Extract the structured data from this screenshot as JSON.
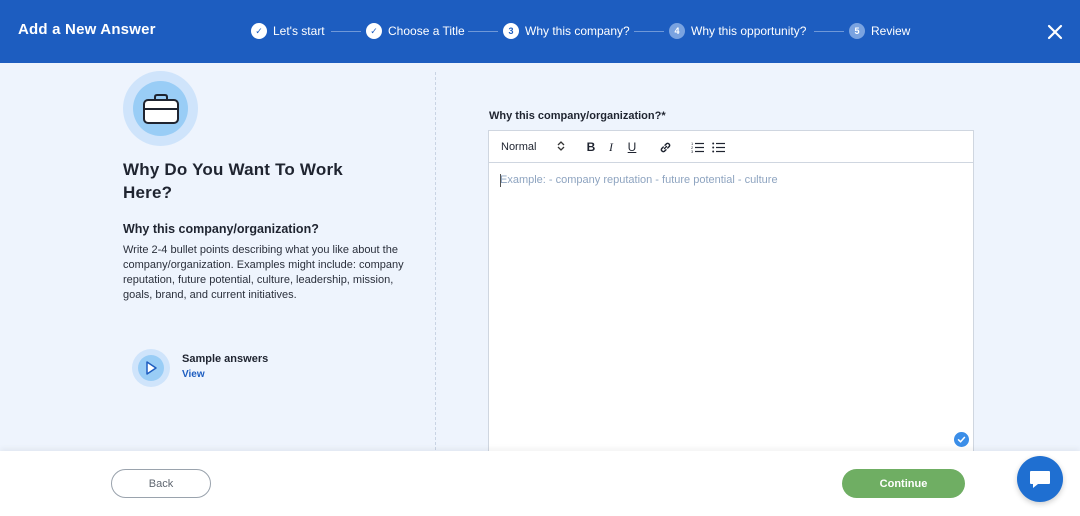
{
  "header": {
    "title": "Add a New Answer",
    "steps": [
      {
        "label": "Let's start",
        "badge": "✓",
        "state": "done"
      },
      {
        "label": "Choose a Title",
        "badge": "✓",
        "state": "done"
      },
      {
        "label": "Why this company?",
        "badge": "3",
        "state": "current"
      },
      {
        "label": "Why this opportunity?",
        "badge": "4",
        "state": "future"
      },
      {
        "label": "Review",
        "badge": "5",
        "state": "future"
      }
    ],
    "close_icon": "close-icon"
  },
  "left": {
    "icon": "briefcase-icon",
    "title": "Why Do You Want To Work Here?",
    "section_title": "Why this company/organization?",
    "section_desc": "Write 2-4 bullet points describing what you like about the company/organization. Examples might include: company reputation, future potential, culture, leadership, mission, goals, brand, and current initiatives.",
    "sample": {
      "icon": "play-icon",
      "label": "Sample answers",
      "link": "View"
    }
  },
  "editor": {
    "label": "Why this company/organization?*",
    "format_select": "Normal",
    "toolbar": [
      "bold-icon",
      "italic-icon",
      "underline-icon",
      "link-icon",
      "ordered-list-icon",
      "bullet-list-icon"
    ],
    "bold": "B",
    "italic": "I",
    "underline": "U",
    "placeholder": "Example: - company reputation - future potential - culture"
  },
  "footer": {
    "back_label": "Back",
    "continue_label": "Continue"
  },
  "colors": {
    "header_bg": "#1d5dc0",
    "page_bg": "#eef4fd",
    "continue_bg": "#6fae63",
    "link": "#1d5dc0",
    "chat_bg": "#1f6fd1"
  }
}
